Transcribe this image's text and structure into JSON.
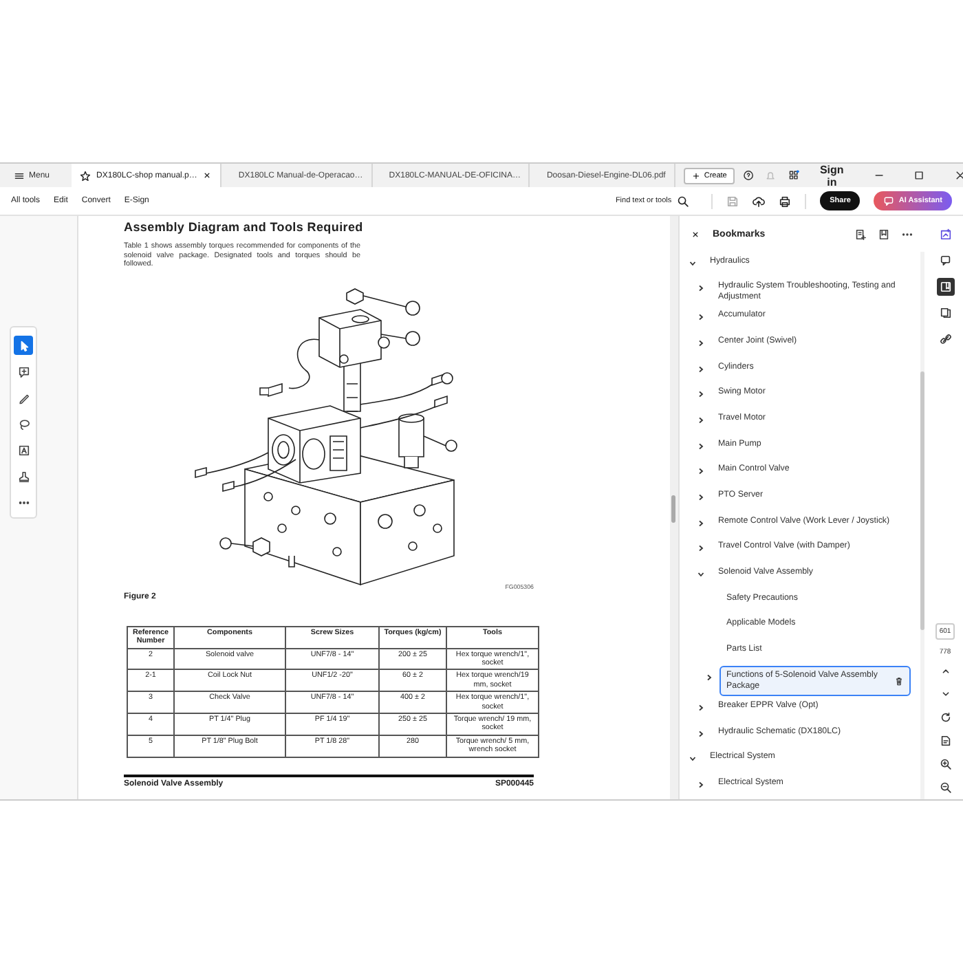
{
  "tabs_bar": {
    "menu": "Menu",
    "tabs": [
      {
        "title": "DX180LC-shop manual.p…",
        "selected": true
      },
      {
        "title": "DX180LC Manual-de-Operacao…",
        "selected": false
      },
      {
        "title": "DX180LC-MANUAL-DE-OFICINA…",
        "selected": false
      },
      {
        "title": "Doosan-Diesel-Engine-DL06.pdf",
        "selected": false
      }
    ],
    "create": "Create",
    "sign_in": "Sign in"
  },
  "toolbar": {
    "menus": [
      "All tools",
      "Edit",
      "Convert",
      "E-Sign"
    ],
    "find": "Find text or tools",
    "share": "Share",
    "ai_assistant": "AI Assistant"
  },
  "tool_palette": [
    {
      "kind": "select",
      "selected": true
    },
    {
      "kind": "comment",
      "selected": false
    },
    {
      "kind": "draw",
      "selected": false
    },
    {
      "kind": "lasso",
      "selected": false
    },
    {
      "kind": "textbox",
      "selected": false
    },
    {
      "kind": "stamp",
      "selected": false
    },
    {
      "kind": "more",
      "selected": false
    }
  ],
  "document": {
    "title": "Assembly Diagram and Tools Required",
    "paragraph": "Table 1 shows assembly torques recommended for components of the solenoid valve package. Designated tools and torques should be followed.",
    "figure_id": "FG005306",
    "caption": "Figure 2",
    "table": {
      "columns": [
        "Reference Number",
        "Components",
        "Screw Sizes",
        "Torques (kg/cm)",
        "Tools"
      ],
      "rows": [
        [
          "2",
          "Solenoid valve",
          "UNF7/8 - 14\"",
          "200 ± 25",
          "Hex torque wrench/1\", socket"
        ],
        [
          "2-1",
          "Coil Lock Nut",
          "UNF1/2 -20\"",
          "60 ± 2",
          "Hex torque wrench/19 mm, socket"
        ],
        [
          "3",
          "Check Valve",
          "UNF7/8 - 14\"",
          "400 ± 2",
          "Hex torque wrench/1\", socket"
        ],
        [
          "4",
          "PT 1/4\" Plug",
          "PF 1/4 19\"",
          "250 ± 25",
          "Torque wrench/ 19 mm, socket"
        ],
        [
          "5",
          "PT 1/8\" Plug Bolt",
          "PT 1/8 28\"",
          "280",
          "Torque wrench/ 5 mm, wrench socket"
        ]
      ]
    },
    "footer_left": "Solenoid Valve Assembly",
    "footer_right": "SP000445"
  },
  "bookmarks": {
    "title": "Bookmarks",
    "items": [
      {
        "label": "Hydraulics",
        "kind": "folder",
        "expanded": true,
        "selected": false,
        "children": [
          {
            "label": "Hydraulic System Troubleshooting, Testing and Adjustment",
            "kind": "folder",
            "expanded": false,
            "selected": false
          },
          {
            "label": "Accumulator",
            "kind": "folder",
            "expanded": false,
            "selected": false
          },
          {
            "label": "Center Joint (Swivel)",
            "kind": "folder",
            "expanded": false,
            "selected": false
          },
          {
            "label": "Cylinders",
            "kind": "folder",
            "expanded": false,
            "selected": false
          },
          {
            "label": "Swing Motor",
            "kind": "folder",
            "expanded": false,
            "selected": false
          },
          {
            "label": "Travel Motor",
            "kind": "folder",
            "expanded": false,
            "selected": false
          },
          {
            "label": "Main Pump",
            "kind": "folder",
            "expanded": false,
            "selected": false
          },
          {
            "label": "Main Control Valve",
            "kind": "folder",
            "expanded": false,
            "selected": false
          },
          {
            "label": "PTO Server",
            "kind": "folder",
            "expanded": false,
            "selected": false
          },
          {
            "label": "Remote Control Valve (Work Lever / Joystick)",
            "kind": "folder",
            "expanded": false,
            "selected": false
          },
          {
            "label": "Travel Control Valve (with Damper)",
            "kind": "folder",
            "expanded": false,
            "selected": false
          },
          {
            "label": "Solenoid Valve Assembly",
            "kind": "folder",
            "expanded": true,
            "selected": false,
            "children": [
              {
                "label": "Safety Precautions",
                "kind": "leaf",
                "selected": false
              },
              {
                "label": "Applicable Models",
                "kind": "leaf",
                "selected": false
              },
              {
                "label": "Parts List",
                "kind": "leaf",
                "selected": false
              },
              {
                "label": "Functions of 5-Solenoid Valve Assembly Package",
                "kind": "folder",
                "expanded": false,
                "selected": true
              }
            ]
          },
          {
            "label": "Breaker EPPR Valve (Opt)",
            "kind": "folder",
            "expanded": false,
            "selected": false
          },
          {
            "label": "Hydraulic Schematic (DX180LC)",
            "kind": "folder",
            "expanded": false,
            "selected": false
          }
        ]
      },
      {
        "label": "Electrical System",
        "kind": "folder",
        "expanded": true,
        "selected": false,
        "children": [
          {
            "label": "Electrical System",
            "kind": "folder",
            "expanded": false,
            "selected": false
          }
        ]
      }
    ]
  },
  "right_rail": [
    {
      "kind": "ai-edit",
      "selected": false
    },
    {
      "kind": "comment",
      "selected": false
    },
    {
      "kind": "bookmarks",
      "selected": true
    },
    {
      "kind": "pages",
      "selected": false
    },
    {
      "kind": "link",
      "selected": false
    }
  ],
  "page_nav": {
    "current": "601",
    "total": "778"
  }
}
